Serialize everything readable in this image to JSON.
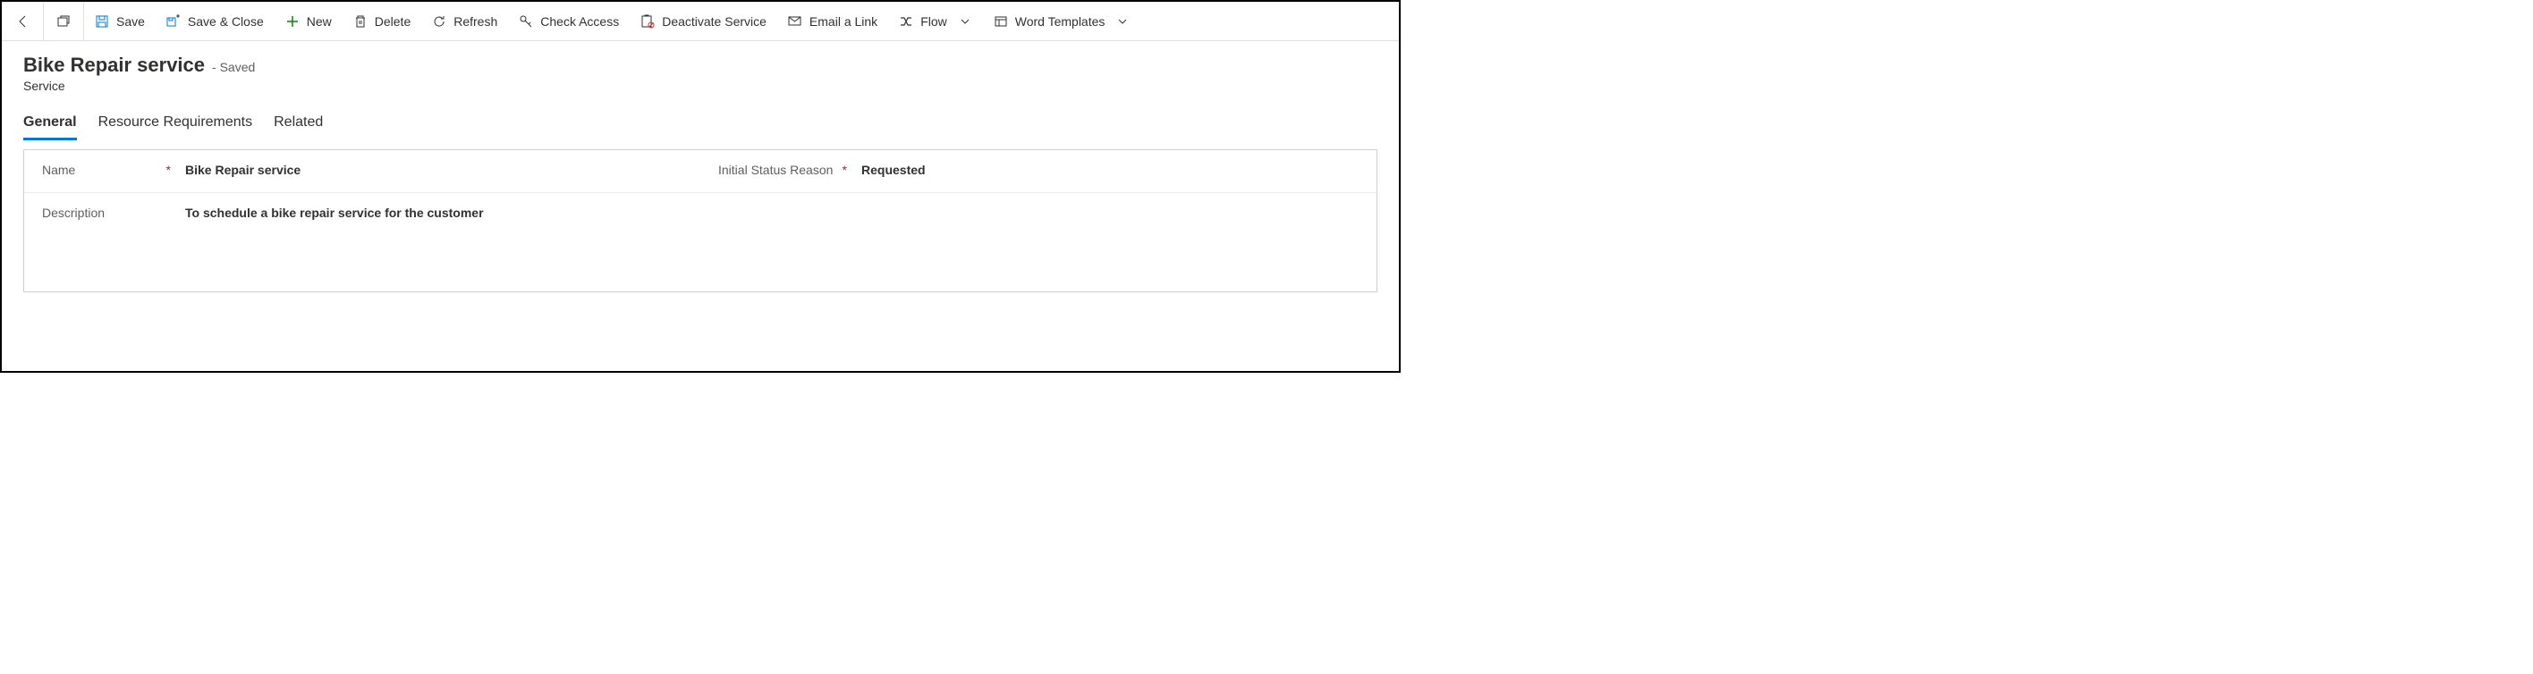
{
  "commandBar": {
    "save": "Save",
    "saveClose": "Save & Close",
    "new": "New",
    "delete": "Delete",
    "refresh": "Refresh",
    "checkAccess": "Check Access",
    "deactivate": "Deactivate Service",
    "emailLink": "Email a Link",
    "flow": "Flow",
    "wordTemplates": "Word Templates"
  },
  "header": {
    "title": "Bike Repair service",
    "savedLabel": "- Saved",
    "entity": "Service"
  },
  "tabs": {
    "general": "General",
    "resourceReq": "Resource Requirements",
    "related": "Related"
  },
  "form": {
    "nameLabel": "Name",
    "nameValue": "Bike Repair service",
    "statusLabel": "Initial Status Reason",
    "statusValue": "Requested",
    "descLabel": "Description",
    "descValue": "To schedule a bike repair service for the customer"
  }
}
